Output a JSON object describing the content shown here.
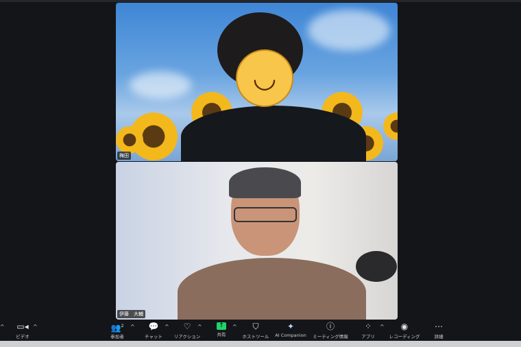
{
  "participants": [
    {
      "name": "梅田"
    },
    {
      "name": "伊藤　大輔"
    }
  ],
  "toolbar": {
    "video": "ビデオ",
    "participants": "参加者",
    "participant_count": "2",
    "chat": "チャット",
    "reactions": "リアクション",
    "share": "共有",
    "host_tools": "ホストツール",
    "ai_companion": "AI Companion",
    "meeting_info": "ミーティング情報",
    "apps": "アプリ",
    "recording": "レコーディング",
    "more": "詳細"
  },
  "colors": {
    "share_accent": "#1fd36a",
    "background": "#141519"
  }
}
